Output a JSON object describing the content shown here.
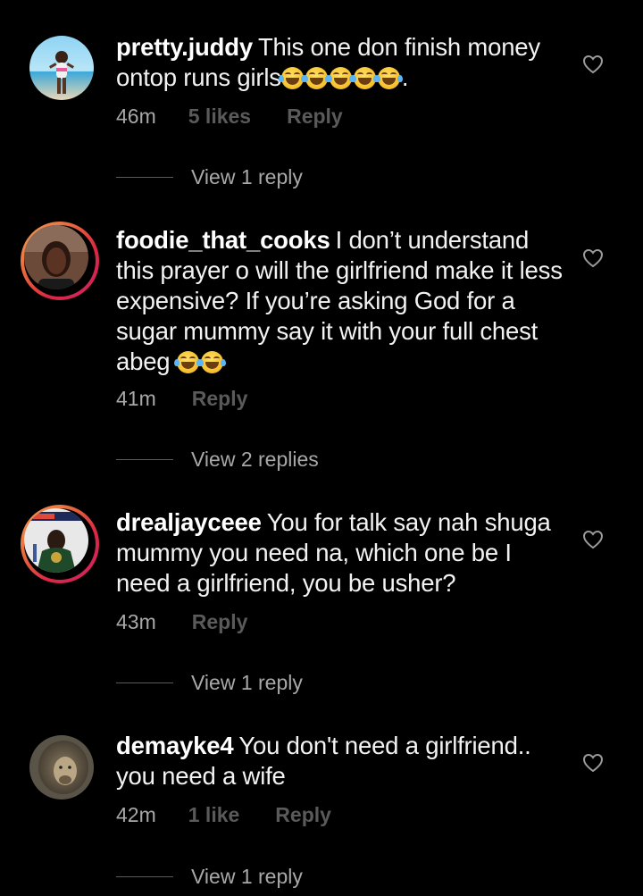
{
  "comments": [
    {
      "username": "pretty.judd​y",
      "text": "This one don finish money ontop runs girls",
      "suffix": ".",
      "emoji_count": 5,
      "time": "46m",
      "likes": "5 likes",
      "reply": "Reply",
      "view_replies": "View 1 reply"
    },
    {
      "username": "foodie_that_cooks",
      "text": "I don’t understand this prayer o will the girlfriend make it less expensive? If you’re asking God for a sugar mummy say it with your full chest abeg",
      "suffix": "",
      "emoji_count": 2,
      "time": "41m",
      "reply": "Reply",
      "view_replies": "View 2 replies"
    },
    {
      "username": "drealjayceee",
      "text": "You for talk say nah shuga mummy you need na, which one be I need a girlfriend, you be usher?",
      "time": "43m",
      "reply": "Reply",
      "view_replies": "View 1 reply"
    },
    {
      "username": "demayke4",
      "text": "You don't need a girlfriend.. you need a wife",
      "time": "42m",
      "likes": "1 like",
      "reply": "Reply",
      "view_replies": "View 1 reply"
    }
  ],
  "colors": {
    "background": "#000000",
    "primary_text": "#f2f2f2",
    "secondary_text": "#a8a8a8",
    "muted_text": "#5a5a5a",
    "story_ring_start": "#f7a25a",
    "story_ring_end": "#cc2366"
  },
  "icons": {
    "like": "heart-outline-icon",
    "emoji": "face-with-tears-of-joy"
  }
}
